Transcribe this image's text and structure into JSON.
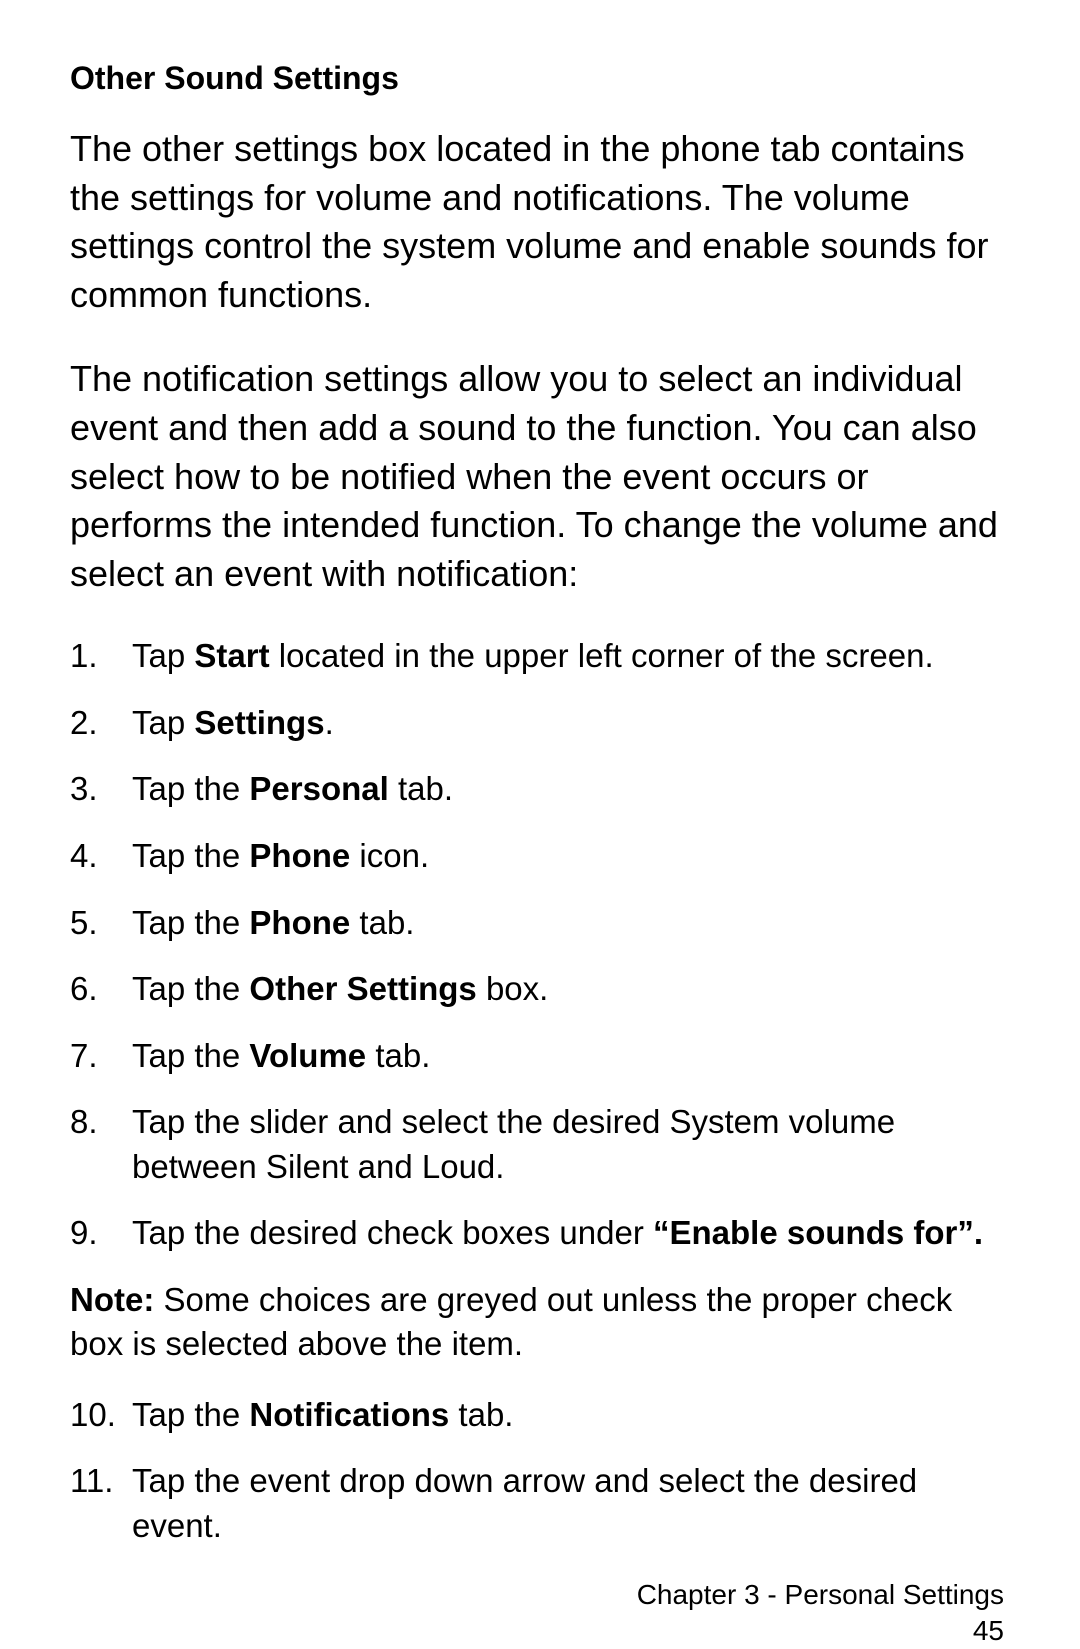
{
  "heading": "Other Sound Settings",
  "para1": "The other settings box located in the phone tab contains the settings for volume and notifications. The volume settings control the system volume and enable sounds for common functions.",
  "para2": "The notification settings allow you to select an individual event and then add a sound to the function. You can also select how to be notified when the event occurs or performs the intended function. To change the volume and select an event with notification:",
  "steps": {
    "s1": {
      "n": "1.",
      "a": "Tap ",
      "b": "Start",
      "c": " located in the upper left corner of the screen."
    },
    "s2": {
      "n": "2.",
      "a": "Tap ",
      "b": "Settings",
      "c": "."
    },
    "s3": {
      "n": "3.",
      "a": "Tap the ",
      "b": "Personal",
      "c": " tab."
    },
    "s4": {
      "n": "4.",
      "a": "Tap the ",
      "b": "Phone",
      "c": " icon."
    },
    "s5": {
      "n": "5.",
      "a": "Tap the ",
      "b": "Phone",
      "c": " tab."
    },
    "s6": {
      "n": "6.",
      "a": "Tap the ",
      "b": "Other Settings",
      "c": " box."
    },
    "s7": {
      "n": "7.",
      "a": "Tap the ",
      "b": "Volume",
      "c": " tab."
    },
    "s8": {
      "n": "8.",
      "a": "Tap the slider and select the desired System volume between Silent and Loud.",
      "b": "",
      "c": ""
    },
    "s9": {
      "n": "9.",
      "a": "Tap the desired check boxes under ",
      "b": "“Enable sounds for”.",
      "c": ""
    },
    "s10": {
      "n": "10.",
      "a": "Tap the ",
      "b": "Notifications",
      "c": " tab."
    },
    "s11": {
      "n": "11.",
      "a": "Tap the event drop down arrow and select the desired event.",
      "b": "",
      "c": ""
    }
  },
  "note": {
    "label": "Note: ",
    "text": "Some choices are greyed out unless the proper check box is selected above the item."
  },
  "footer": {
    "chapter": "Chapter 3 - Personal Settings",
    "page": "45"
  }
}
